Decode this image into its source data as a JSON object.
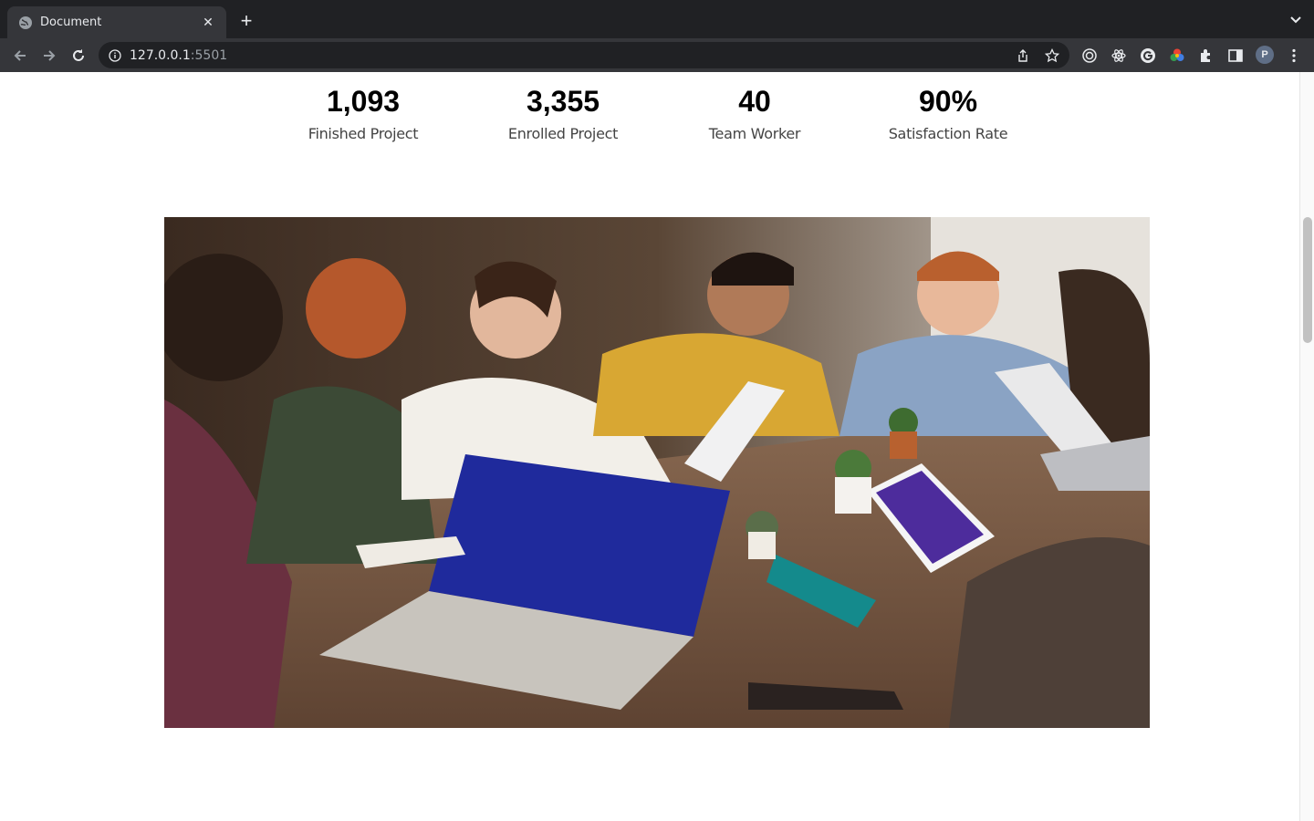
{
  "browser": {
    "tab_title": "Document",
    "url_host": "127.0.0.1",
    "url_port": ":5501",
    "profile_initial": "P",
    "icons": [
      "globe-icon",
      "close-icon",
      "plus-icon",
      "chevron-down-icon",
      "back-icon",
      "forward-icon",
      "reload-icon",
      "info-icon",
      "share-icon",
      "star-icon",
      "extension-target-icon",
      "extension-react-icon",
      "extension-g-icon",
      "extension-color-icon",
      "puzzle-icon",
      "side-panel-icon",
      "kebab-menu-icon"
    ]
  },
  "stats": [
    {
      "value": "1,093",
      "label": "Finished Project"
    },
    {
      "value": "3,355",
      "label": "Enrolled Project"
    },
    {
      "value": "40",
      "label": "Team Worker"
    },
    {
      "value": "90%",
      "label": "Satisfaction Rate"
    }
  ],
  "colors": {
    "chrome_dark": "#202124",
    "chrome_tab": "#35363a",
    "page_bg": "#ffffff"
  }
}
